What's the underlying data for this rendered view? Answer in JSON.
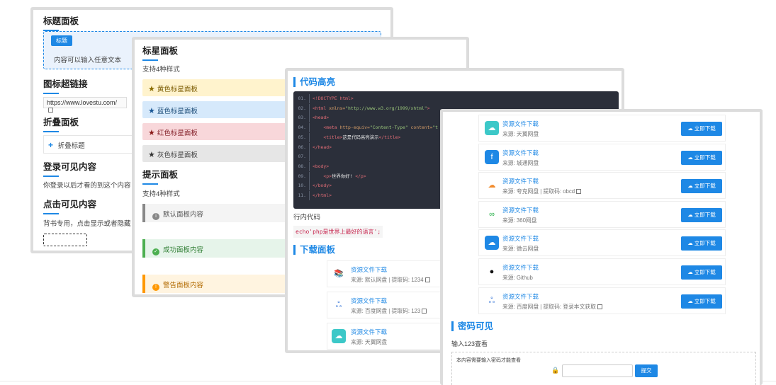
{
  "card_a": {
    "title_panel": "标题面板",
    "tag": "标题",
    "box_text": "内容可以输入任意文本",
    "title_link": "图标超链接",
    "link_text": "https://www.lovestu.com/",
    "title_fold": "折叠面板",
    "fold_label": "折叠标题",
    "title_login": "登录可见内容",
    "login_text": "你登录以后才看的到这个内容",
    "title_click": "点击可见内容",
    "click_text": "背书专用，点击显示或者隐藏"
  },
  "card_b": {
    "title_star": "标星面板",
    "star_sub": "支持4种样式",
    "stars": [
      {
        "label": "黄色标星面板",
        "bg": "#fff3cd",
        "color": "#7a5a00",
        "star": "#8a6d00"
      },
      {
        "label": "蓝色标星面板",
        "bg": "#d6e9fb",
        "color": "#1f4e79",
        "star": "#1a5796"
      },
      {
        "label": "红色标星面板",
        "bg": "#f8d7da",
        "color": "#842029",
        "star": "#8b1a1a"
      },
      {
        "label": "灰色标星面板",
        "bg": "#e6e6e6",
        "color": "#444444",
        "star": "#333333"
      }
    ],
    "title_tip": "提示面板",
    "tip_sub": "支持4种样式",
    "tips": [
      {
        "label": "默认面板内容",
        "bg": "#f4f4f4",
        "border": "#888888",
        "color": "#555555",
        "icon": "i"
      },
      {
        "label": "成功面板内容",
        "bg": "#e6f4ea",
        "border": "#4caf50",
        "color": "#2e7d32",
        "icon": "✓"
      },
      {
        "label": "警告面板内容",
        "bg": "#fff4e0",
        "border": "#ff9800",
        "color": "#b26a00",
        "icon": "!"
      }
    ]
  },
  "card_c": {
    "title_code": "代码高亮",
    "code": [
      {
        "n": "01.",
        "parts": [
          [
            "tg",
            "<!DOCTYPE html>"
          ]
        ]
      },
      {
        "n": "02.",
        "parts": [
          [
            "tg",
            "<html "
          ],
          [
            "at",
            "xmlns="
          ],
          [
            "st",
            "\"http://www.w3.org/1999/xhtml\""
          ],
          [
            "tg",
            ">"
          ]
        ]
      },
      {
        "n": "03.",
        "parts": [
          [
            "tg",
            "<head>"
          ]
        ]
      },
      {
        "n": "04.",
        "parts": [
          [
            "tx",
            "    "
          ],
          [
            "tg",
            "<meta "
          ],
          [
            "at",
            "http-equiv="
          ],
          [
            "st",
            "\"Content-Type\" "
          ],
          [
            "at",
            "content="
          ],
          [
            "st",
            "\"t"
          ]
        ]
      },
      {
        "n": "05.",
        "parts": [
          [
            "tx",
            "    "
          ],
          [
            "tg",
            "<title>"
          ],
          [
            "tx",
            "这是代码高亮演示"
          ],
          [
            "tg",
            "</title>"
          ]
        ]
      },
      {
        "n": "06.",
        "parts": [
          [
            "tg",
            "</head>"
          ]
        ]
      },
      {
        "n": "07.",
        "parts": []
      },
      {
        "n": "08.",
        "parts": [
          [
            "tg",
            "<body>"
          ]
        ]
      },
      {
        "n": "09.",
        "parts": [
          [
            "tx",
            "    "
          ],
          [
            "tg",
            "<p>"
          ],
          [
            "tx",
            "世界你好! "
          ],
          [
            "tg",
            "</p>"
          ]
        ]
      },
      {
        "n": "10.",
        "parts": [
          [
            "tg",
            "</body>"
          ]
        ]
      },
      {
        "n": "11.",
        "parts": [
          [
            "tg",
            "</html>"
          ]
        ]
      }
    ],
    "inline_label": "行内代码",
    "inline_code": "echo'php是世界上最好的语言';",
    "title_download": "下载面板",
    "downloads": [
      {
        "title": "资源文件下载",
        "source": "来源: 默认网盘 | 提取码: 1234",
        "copy": true,
        "icon": "📚",
        "icon_bg": "#ffffff",
        "icon_color": "#444444"
      },
      {
        "title": "资源文件下载",
        "source": "来源: 百度网盘 | 提取码: 123",
        "copy": true,
        "icon": "ஃ",
        "icon_bg": "#ffffff",
        "icon_color": "#2f6fd6"
      },
      {
        "title": "资源文件下载",
        "source": "来源: 天翼网盘",
        "copy": false,
        "icon": "☁",
        "icon_bg": "#3cc8c8",
        "icon_color": "#ffffff"
      }
    ]
  },
  "card_d": {
    "button_label": "☁ 立即下载",
    "rows": [
      {
        "title": "资源文件下载",
        "source": "来源: 天翼网盘",
        "copy": false,
        "icon": "☁",
        "icon_bg": "#3cc8c8",
        "icon_color": "#ffffff"
      },
      {
        "title": "资源文件下载",
        "source": "来源: 城通网盘",
        "copy": false,
        "icon": "f",
        "icon_bg": "#1e88e5",
        "icon_color": "#ffffff"
      },
      {
        "title": "资源文件下载",
        "source": "来源: 夸克网盘 | 提取码: obcd",
        "copy": true,
        "icon": "☁",
        "icon_bg": "#ffffff",
        "icon_color": "#f28b2c"
      },
      {
        "title": "资源文件下载",
        "source": "来源: 360网盘",
        "copy": false,
        "icon": "∞",
        "icon_bg": "#ffffff",
        "icon_color": "#2bb24c"
      },
      {
        "title": "资源文件下载",
        "source": "来源: 微云网盘",
        "copy": false,
        "icon": "☁",
        "icon_bg": "#1e88e5",
        "icon_color": "#ffffff"
      },
      {
        "title": "资源文件下载",
        "source": "来源: Github",
        "copy": false,
        "icon": "●",
        "icon_bg": "#ffffff",
        "icon_color": "#111111"
      },
      {
        "title": "资源文件下载",
        "source": "来源: 百度网盘 | 提取码: 登录本文获取",
        "copy": true,
        "icon": "ஃ",
        "icon_bg": "#ffffff",
        "icon_color": "#2f6fd6"
      }
    ],
    "title_pw": "密码可见",
    "pw_text": "输入123查看",
    "pw_label": "本内容需要输入密码才能查看",
    "submit": "提交"
  }
}
